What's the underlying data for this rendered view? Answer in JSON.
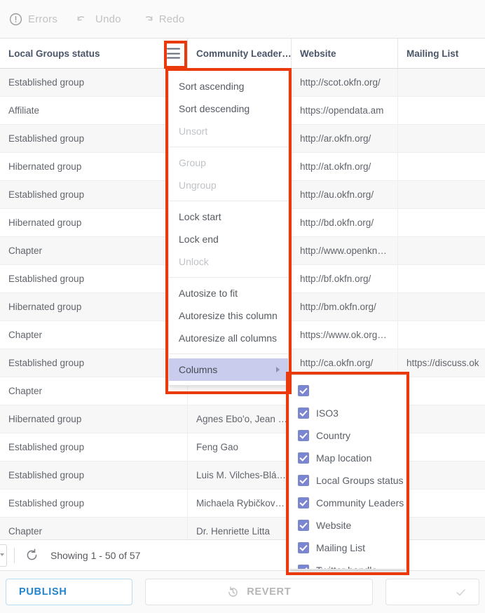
{
  "toolbar": {
    "errors_label": "Errors",
    "undo_label": "Undo",
    "redo_label": "Redo",
    "errors_icon": "alert-circle-icon",
    "undo_icon": "undo-arrow-icon",
    "redo_icon": "redo-arrow-icon"
  },
  "grid": {
    "columns": [
      {
        "label": "Local Groups status",
        "has_menu": true
      },
      {
        "label": "Community Leader…",
        "has_menu": false
      },
      {
        "label": "Website",
        "has_menu": false
      },
      {
        "label": "Mailing List",
        "has_menu": false
      }
    ],
    "rows": [
      {
        "status": "Established group",
        "leader": "",
        "website": "http://scot.okfn.org/",
        "mailing": ""
      },
      {
        "status": "Affiliate",
        "leader": "",
        "website": "https://opendata.am",
        "mailing": ""
      },
      {
        "status": "Established group",
        "leader": "",
        "website": "http://ar.okfn.org/",
        "mailing": ""
      },
      {
        "status": "Hibernated group",
        "leader": "",
        "website": "http://at.okfn.org/",
        "mailing": ""
      },
      {
        "status": "Established group",
        "leader": "",
        "website": "http://au.okfn.org/",
        "mailing": ""
      },
      {
        "status": "Hibernated group",
        "leader": "",
        "website": "http://bd.okfn.org/",
        "mailing": ""
      },
      {
        "status": "Chapter",
        "leader": "",
        "website": "http://www.openkn…",
        "mailing": ""
      },
      {
        "status": "Established group",
        "leader": "",
        "website": "http://bf.okfn.org/",
        "mailing": ""
      },
      {
        "status": "Hibernated group",
        "leader": "",
        "website": "http://bm.okfn.org/",
        "mailing": ""
      },
      {
        "status": "Chapter",
        "leader": "",
        "website": "https://www.ok.org…",
        "mailing": ""
      },
      {
        "status": "Established group",
        "leader": "",
        "website": "http://ca.okfn.org/",
        "mailing": "https://discuss.ok"
      },
      {
        "status": "Chapter",
        "leader": "",
        "website": "",
        "mailing": ""
      },
      {
        "status": "Hibernated group",
        "leader": "Agnes Ebo'o, Jean …",
        "website": "",
        "mailing": ""
      },
      {
        "status": "Established group",
        "leader": "Feng Gao",
        "website": "",
        "mailing": ""
      },
      {
        "status": "Established group",
        "leader": "Luis M. Vilches-Blá…",
        "website": "",
        "mailing": ""
      },
      {
        "status": "Established group",
        "leader": "Michaela Rybičkov…",
        "website": "",
        "mailing": ""
      },
      {
        "status": "Chapter",
        "leader": "Dr. Henriette Litta",
        "website": "",
        "mailing": ""
      }
    ]
  },
  "column_menu": {
    "items": [
      {
        "label": "Sort ascending",
        "state": "enabled"
      },
      {
        "label": "Sort descending",
        "state": "enabled"
      },
      {
        "label": "Unsort",
        "state": "disabled"
      },
      {
        "label": "",
        "state": "separator"
      },
      {
        "label": "Group",
        "state": "disabled"
      },
      {
        "label": "Ungroup",
        "state": "disabled"
      },
      {
        "label": "",
        "state": "separator"
      },
      {
        "label": "Lock start",
        "state": "enabled"
      },
      {
        "label": "Lock end",
        "state": "enabled"
      },
      {
        "label": "Unlock",
        "state": "disabled"
      },
      {
        "label": "",
        "state": "separator"
      },
      {
        "label": "Autosize to fit",
        "state": "enabled"
      },
      {
        "label": "Autoresize this column",
        "state": "enabled"
      },
      {
        "label": "Autoresize all columns",
        "state": "enabled"
      },
      {
        "label": "",
        "state": "separator"
      },
      {
        "label": "Columns",
        "state": "active"
      }
    ]
  },
  "columns_submenu": {
    "items": [
      {
        "label": "",
        "checked": true
      },
      {
        "label": "ISO3",
        "checked": true
      },
      {
        "label": "Country",
        "checked": true
      },
      {
        "label": "Map location",
        "checked": true
      },
      {
        "label": "Local Groups status",
        "checked": true
      },
      {
        "label": "Community Leaders",
        "checked": true
      },
      {
        "label": "Website",
        "checked": true
      },
      {
        "label": "Mailing List",
        "checked": true
      },
      {
        "label": "Twitter handle",
        "checked": true
      }
    ]
  },
  "pager": {
    "refresh_icon": "refresh-icon",
    "showing_text": "Showing 1 - 50 of 57"
  },
  "actions": {
    "publish_label": "PUBLISH",
    "revert_label": "REVERT",
    "revert_icon": "history-restore-icon",
    "confirm_icon": "check-icon"
  },
  "colors": {
    "accent_blue": "#2185d0",
    "checkbox_purple": "#7b86ce",
    "menu_highlight": "#c9ccec",
    "annotation_red": "#ea3a0c",
    "header_text": "#4a5568"
  }
}
